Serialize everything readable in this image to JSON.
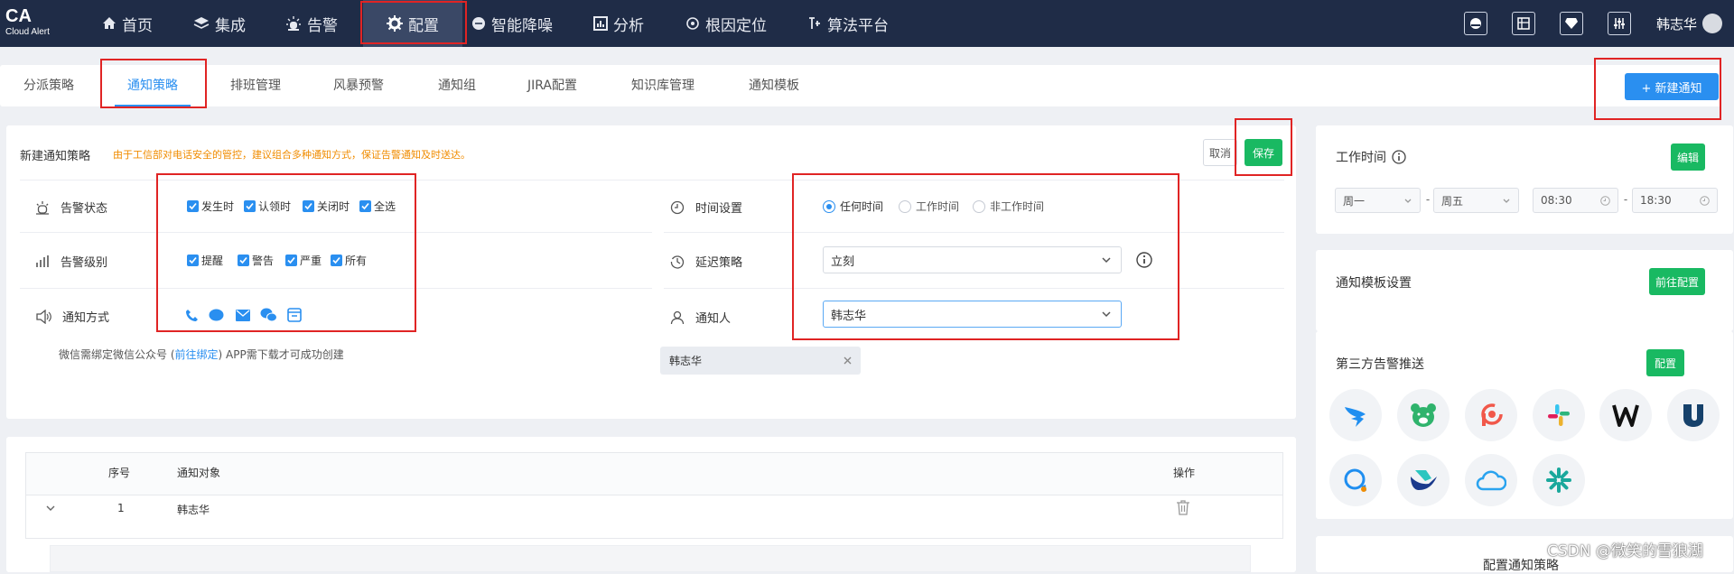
{
  "logo": {
    "title": "CA",
    "subtitle": "Cloud Alert"
  },
  "nav": [
    {
      "label": "首页",
      "icon": "home-icon"
    },
    {
      "label": "集成",
      "icon": "layers-icon"
    },
    {
      "label": "告警",
      "icon": "alarm-icon"
    },
    {
      "label": "配置",
      "icon": "gear-icon"
    },
    {
      "label": "智能降噪",
      "icon": "noise-icon"
    },
    {
      "label": "分析",
      "icon": "chart-icon"
    },
    {
      "label": "根因定位",
      "icon": "target-icon"
    },
    {
      "label": "算法平台",
      "icon": "algorithm-icon"
    }
  ],
  "user": {
    "name": "韩志华"
  },
  "tabs": [
    "分派策略",
    "通知策略",
    "排班管理",
    "风暴预警",
    "通知组",
    "JIRA配置",
    "知识库管理",
    "通知模板"
  ],
  "new_button": "+ 新建通知",
  "form": {
    "title": "新建通知策略",
    "warning": "由于工信部对电话安全的管控，建议组合多种通知方式，保证告警通知及时送达。",
    "cancel": "取消",
    "save": "保存",
    "status_label": "告警状态",
    "status_opts": [
      "发生时",
      "认领时",
      "关闭时",
      "全选"
    ],
    "level_label": "告警级别",
    "level_opts": [
      "提醒",
      "警告",
      "严重",
      "所有"
    ],
    "method_label": "通知方式",
    "wechat_note_a": "微信需绑定微信公众号 (",
    "wechat_note_link": "前往绑定",
    "wechat_note_b": ") APP需下载才可成功创建",
    "time_label": "时间设置",
    "time_opts": [
      "任何时间",
      "工作时间",
      "非工作时间"
    ],
    "delay_label": "延迟策略",
    "delay_value": "立刻",
    "person_label": "通知人",
    "person_value": "韩志华",
    "person_tag": "韩志华"
  },
  "table": {
    "headers": [
      "序号",
      "通知对象",
      "操作"
    ],
    "rows": [
      {
        "index": "1",
        "target": "韩志华"
      }
    ]
  },
  "work_time": {
    "title": "工作时间",
    "edit": "编辑",
    "day_from": "周一",
    "dash": "-",
    "day_to": "周五",
    "time_from": "08:30",
    "time_to": "18:30"
  },
  "template": {
    "title": "通知模板设置",
    "button": "前往配置"
  },
  "third_party": {
    "title": "第三方告警推送",
    "button": "配置"
  },
  "bottom_partial": "配置通知策略",
  "watermark": "CSDN @微笑的雪狼湖",
  "colors": {
    "topbar": "#1f2c47",
    "accent": "#2a8ff0",
    "green": "#19b962",
    "warning": "#f08c00",
    "highlight": "#e02424"
  }
}
